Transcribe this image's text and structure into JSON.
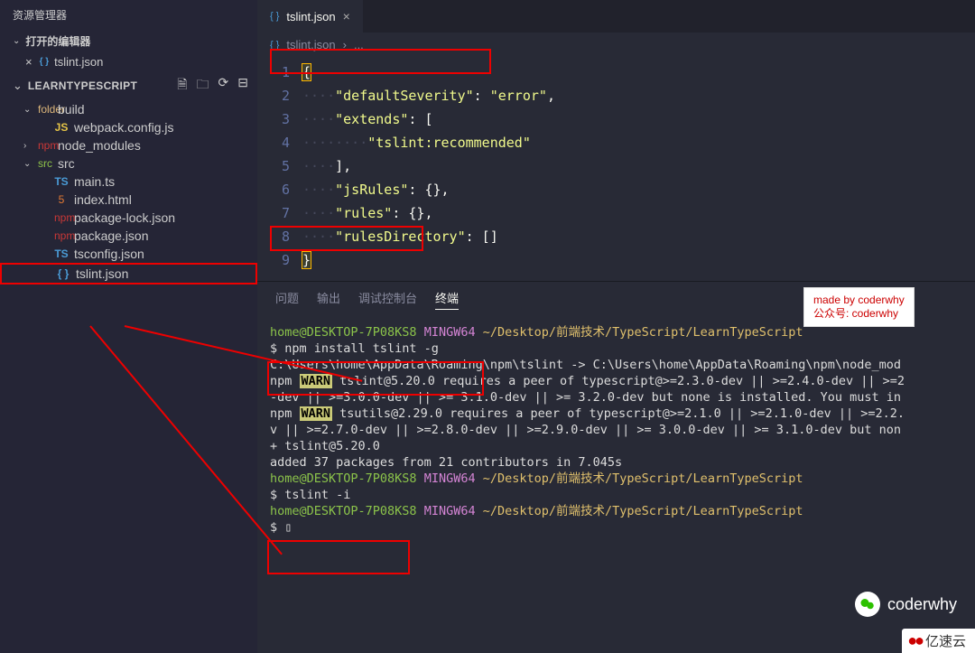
{
  "sidebar": {
    "title": "资源管理器",
    "openEditors": {
      "label": "打开的编辑器",
      "items": [
        {
          "label": "tslint.json"
        }
      ]
    },
    "project": {
      "name": "LEARNTYPESCRIPT",
      "actions": [
        "new-file",
        "new-folder",
        "refresh",
        "collapse"
      ]
    },
    "tree": [
      {
        "chev": "⌄",
        "icon": "folder",
        "iconClass": "ic-folder",
        "label": "build",
        "depth": 1
      },
      {
        "chev": "",
        "icon": "JS",
        "iconClass": "ic-js",
        "label": "webpack.config.js",
        "depth": 2
      },
      {
        "chev": "›",
        "icon": "npm",
        "iconClass": "ic-npm",
        "label": "node_modules",
        "depth": 1
      },
      {
        "chev": "⌄",
        "icon": "src",
        "iconClass": "ic-folder-src",
        "label": "src",
        "depth": 1
      },
      {
        "chev": "",
        "icon": "TS",
        "iconClass": "ic-ts",
        "label": "main.ts",
        "depth": 2
      },
      {
        "chev": "",
        "icon": "5",
        "iconClass": "ic-html",
        "label": "index.html",
        "depth": 1,
        "pad": 2
      },
      {
        "chev": "",
        "icon": "npm",
        "iconClass": "ic-npm",
        "label": "package-lock.json",
        "depth": 1,
        "pad": 2
      },
      {
        "chev": "",
        "icon": "npm",
        "iconClass": "ic-npm",
        "label": "package.json",
        "depth": 1,
        "pad": 2
      },
      {
        "chev": "",
        "icon": "TS",
        "iconClass": "ic-ts",
        "label": "tsconfig.json",
        "depth": 1,
        "pad": 2
      },
      {
        "chev": "",
        "icon": "{ }",
        "iconClass": "ic-tsl",
        "label": "tslint.json",
        "depth": 1,
        "pad": 2,
        "boxed": true
      }
    ]
  },
  "tab": {
    "label": "tslint.json"
  },
  "breadcrumb": {
    "file": "tslint.json",
    "sep": "›",
    "more": "..."
  },
  "code": {
    "lines": [
      {
        "n": "1",
        "seg": [
          {
            "c": "tok-punc sel",
            "t": "{"
          }
        ]
      },
      {
        "n": "2",
        "seg": [
          {
            "c": "guide",
            "t": "····"
          },
          {
            "c": "tok-str",
            "t": "\"defaultSeverity\""
          },
          {
            "c": "tok-punc",
            "t": ": "
          },
          {
            "c": "tok-str",
            "t": "\"error\""
          },
          {
            "c": "tok-punc",
            "t": ","
          }
        ]
      },
      {
        "n": "3",
        "seg": [
          {
            "c": "guide",
            "t": "····"
          },
          {
            "c": "tok-str",
            "t": "\"extends\""
          },
          {
            "c": "tok-punc",
            "t": ": ["
          }
        ]
      },
      {
        "n": "4",
        "seg": [
          {
            "c": "guide",
            "t": "········"
          },
          {
            "c": "tok-str",
            "t": "\"tslint:recommended\""
          }
        ]
      },
      {
        "n": "5",
        "seg": [
          {
            "c": "guide",
            "t": "····"
          },
          {
            "c": "tok-punc",
            "t": "],"
          }
        ]
      },
      {
        "n": "6",
        "seg": [
          {
            "c": "guide",
            "t": "····"
          },
          {
            "c": "tok-str",
            "t": "\"jsRules\""
          },
          {
            "c": "tok-punc",
            "t": ": {},"
          }
        ]
      },
      {
        "n": "7",
        "seg": [
          {
            "c": "guide",
            "t": "····"
          },
          {
            "c": "tok-str",
            "t": "\"rules\""
          },
          {
            "c": "tok-punc",
            "t": ": {},"
          }
        ]
      },
      {
        "n": "8",
        "seg": [
          {
            "c": "guide",
            "t": "····"
          },
          {
            "c": "tok-str",
            "t": "\"rulesDirectory\""
          },
          {
            "c": "tok-punc",
            "t": ": []"
          }
        ]
      },
      {
        "n": "9",
        "seg": [
          {
            "c": "tok-punc sel",
            "t": "}"
          }
        ]
      }
    ]
  },
  "panel": {
    "tabs": [
      {
        "label": "问题",
        "active": false
      },
      {
        "label": "输出",
        "active": false
      },
      {
        "label": "调试控制台",
        "active": false
      },
      {
        "label": "终端",
        "active": true
      }
    ]
  },
  "terminal": {
    "lines": [
      [
        {
          "c": "t-user",
          "t": "home@DESKTOP-7P08KS8"
        },
        {
          "c": "",
          "t": " "
        },
        {
          "c": "t-mingw",
          "t": "MINGW64"
        },
        {
          "c": "",
          "t": " "
        },
        {
          "c": "t-path",
          "t": "~/Desktop/前端技术/TypeScript/LearnTypeScript"
        }
      ],
      [
        {
          "c": "t-cmd",
          "t": "$ npm install tslint -g"
        }
      ],
      [
        {
          "c": "",
          "t": "C:\\Users\\home\\AppData\\Roaming\\npm\\tslint -> C:\\Users\\home\\AppData\\Roaming\\npm\\node_mod"
        }
      ],
      [
        {
          "c": "",
          "t": "npm "
        },
        {
          "c": "t-warn",
          "t": "WARN"
        },
        {
          "c": "",
          "t": " tslint@5.20.0 requires a peer of typescript@>=2.3.0-dev || >=2.4.0-dev || >=2"
        }
      ],
      [
        {
          "c": "",
          "t": "-dev || >=3.0.0-dev || >= 3.1.0-dev || >= 3.2.0-dev but none is installed. You must in"
        }
      ],
      [
        {
          "c": "",
          "t": "npm "
        },
        {
          "c": "t-warn",
          "t": "WARN"
        },
        {
          "c": "",
          "t": " tsutils@2.29.0 requires a peer of typescript@>=2.1.0 || >=2.1.0-dev || >=2.2."
        }
      ],
      [
        {
          "c": "",
          "t": "v || >=2.7.0-dev || >=2.8.0-dev || >=2.9.0-dev || >= 3.0.0-dev || >= 3.1.0-dev but non"
        }
      ],
      [
        {
          "c": "",
          "t": ""
        }
      ],
      [
        {
          "c": "",
          "t": "+ tslint@5.20.0"
        }
      ],
      [
        {
          "c": "",
          "t": "added 37 packages from 21 contributors in 7.045s"
        }
      ],
      [
        {
          "c": "",
          "t": ""
        }
      ],
      [
        {
          "c": "t-user",
          "t": "home@DESKTOP-7P08KS8"
        },
        {
          "c": "",
          "t": " "
        },
        {
          "c": "t-mingw",
          "t": "MINGW64"
        },
        {
          "c": "",
          "t": " "
        },
        {
          "c": "t-path",
          "t": "~/Desktop/前端技术/TypeScript/LearnTypeScript"
        }
      ],
      [
        {
          "c": "t-cmd",
          "t": "$ tslint -i"
        }
      ],
      [
        {
          "c": "",
          "t": ""
        }
      ],
      [
        {
          "c": "t-user",
          "t": "home@DESKTOP-7P08KS8"
        },
        {
          "c": "",
          "t": " "
        },
        {
          "c": "t-mingw",
          "t": "MINGW64"
        },
        {
          "c": "",
          "t": " "
        },
        {
          "c": "t-path",
          "t": "~/Desktop/前端技术/TypeScript/LearnTypeScript"
        }
      ],
      [
        {
          "c": "t-cmd",
          "t": "$ ▯"
        }
      ]
    ]
  },
  "callout": {
    "l1": "made by coderwhy",
    "l2": "公众号: coderwhy"
  },
  "watermark1": "coderwhy",
  "watermark2": "亿速云"
}
